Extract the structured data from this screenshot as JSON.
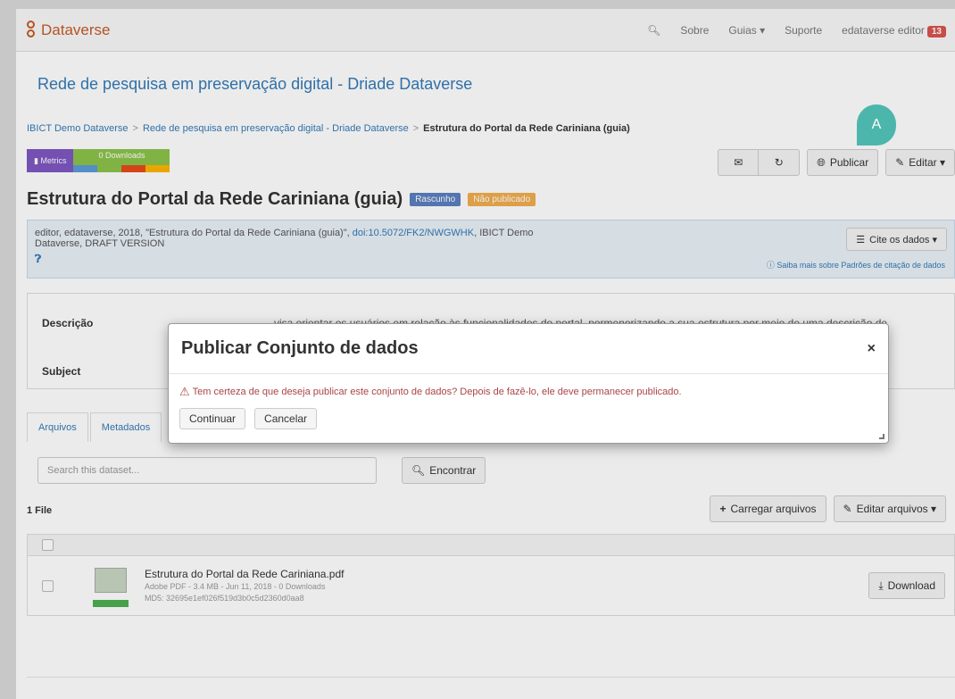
{
  "navbar": {
    "brand": "Dataverse",
    "items": [
      "Sobre",
      "Guias ▾",
      "Suporte"
    ],
    "user": "edataverse editor",
    "notifications": "13"
  },
  "dataverse_title": "Rede de pesquisa em preservação digital - Driade Dataverse",
  "breadcrumb": [
    "IBICT Demo Dataverse",
    "Rede de pesquisa em preservação digital - Driade Dataverse",
    "Estrutura do Portal da Rede Cariniana (guia)"
  ],
  "metrics": {
    "label": "Metrics",
    "downloads": "0 Downloads"
  },
  "toolbar": {
    "publish": "Publicar",
    "edit": "Editar ▾"
  },
  "dataset": {
    "title": "Estrutura do Portal da Rede Cariniana (guia)",
    "draft_label": "Rascunho",
    "unpublished_label": "Não publicado"
  },
  "citation": {
    "text": "editor, edataverse, 2018, \"Estrutura do Portal da Rede Cariniana (guia)\", ",
    "doi": "doi:10.5072/FK2/NWGWHK",
    "text2": ", IBICT Demo",
    "line2": "Dataverse, DRAFT VERSION",
    "cite_button": "Cite os dados ▾",
    "help": "Saiba mais sobre Padrões de citação de dados"
  },
  "metadata": {
    "description_label": "Descrição",
    "description_value": "visa orientar os usuários em relação às funcionalidades do portal, pormenorizando a sua estrutura por meio de uma descrição de",
    "subject_label": "Subject"
  },
  "tabs": [
    "Arquivos",
    "Metadados"
  ],
  "search": {
    "placeholder": "Search this dataset...",
    "button": "Encontrar"
  },
  "files": {
    "count": "1 File",
    "upload_button": "Carregar arquivos",
    "edit_button": "Editar arquivos ▾",
    "items": [
      {
        "name": "Estrutura do Portal da Rede Cariniana.pdf",
        "meta": "Adobe PDF - 3.4 MB - Jun 11, 2018 - 0 Downloads",
        "md5": "MD5: 32695e1ef026f519d3b0c5d2360d0aa8",
        "download": "Download"
      }
    ]
  },
  "callout": "A",
  "modal": {
    "title": "Publicar Conjunto de dados",
    "close": "×",
    "warning": "Tem certeza de que deseja publicar este conjunto de dados? Depois de fazê-lo, ele deve permanecer publicado.",
    "continue": "Continuar",
    "cancel": "Cancelar"
  },
  "colors": {
    "brand": "#c55b28",
    "link": "#337ab7",
    "warning": "#a94442",
    "callout": "#4db6ac",
    "metrics": "#7e57c2",
    "downloads": "#8bc34a"
  }
}
